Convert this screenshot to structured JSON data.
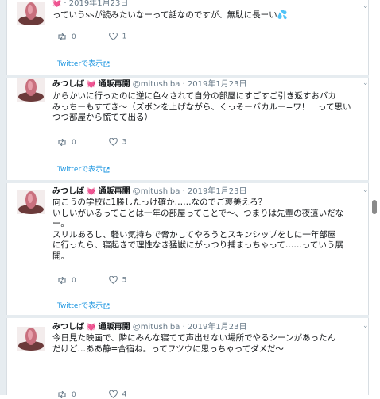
{
  "colors": {
    "link": "#1b95e0",
    "muted": "#657786",
    "heart": "#e0245e",
    "text": "#14171a"
  },
  "tweets": [
    {
      "name": "",
      "badge": "",
      "handle": "",
      "date": "2019年1月23日",
      "lines": [
        "っていうssが読みたいなーって話なのですが、無駄に長ーい💦"
      ],
      "retweets": "0",
      "likes": "1",
      "view_label": "Twitterで表示"
    },
    {
      "name": "みつしば",
      "badge": "通販再開",
      "handle": "@mitushiba",
      "date": "2019年1月23日",
      "lines": [
        "からかいに行ったのに逆に色々されて自分の部屋にすごすご引き返すおバカ",
        "みっちーもすてき〜（ズボンを上げながら、くっそーバカルー=ワ！　って思い",
        "つつ部屋から慌てて出る）"
      ],
      "retweets": "0",
      "likes": "3",
      "view_label": "Twitterで表示"
    },
    {
      "name": "みつしば",
      "badge": "通販再開",
      "handle": "@mitushiba",
      "date": "2019年1月23日",
      "lines": [
        "向こうの学校に1勝したっけ確か……なのでご褒美えろ？",
        "いしいがいるってことは一年の部屋ってことで〜、つまりは先輩の夜這いだな",
        "ー。",
        "スリルあるし、軽い気持ちで脅かしてやろうとスキンシップをしに一年部屋",
        "に行ったら、寝起きで理性なき猛獣にがっつり捕まっちゃって……っていう展",
        "開。"
      ],
      "retweets": "0",
      "likes": "5",
      "view_label": "Twitterで表示"
    },
    {
      "name": "みつしば",
      "badge": "通販再開",
      "handle": "@mitushiba",
      "date": "2019年1月23日",
      "lines": [
        "今日見た映画で、隣にみんな寝てて声出せない場所でやるシーンがあったん",
        "だけど…ああ静=合宿ね。ってフツウに思っちゃってダメだ〜"
      ],
      "retweets": "0",
      "likes": "4",
      "view_label": ""
    }
  ]
}
